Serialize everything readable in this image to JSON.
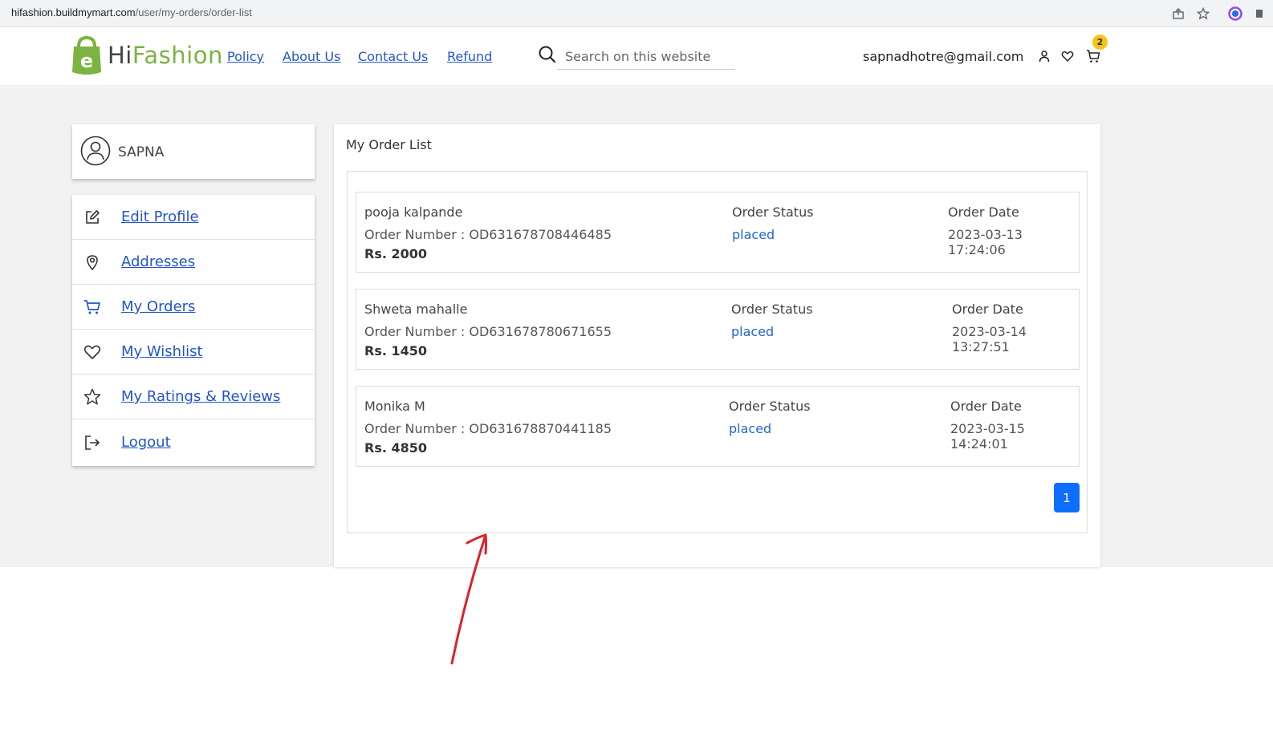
{
  "browser": {
    "url_host": "hifashion.buildmymart.com",
    "url_path": "/user/my-orders/order-list"
  },
  "header": {
    "logo_prefix": "Hi",
    "logo_suffix": "Fashion",
    "nav": [
      {
        "label": "Policy"
      },
      {
        "label": "About Us"
      },
      {
        "label": "Contact Us"
      },
      {
        "label": "Refund"
      }
    ],
    "search_placeholder": "Search on this website",
    "user_email": "sapnadhotre@gmail.com",
    "cart_count": "2"
  },
  "sidebar": {
    "profile_name": "SAPNA",
    "menu": [
      {
        "label": "Edit Profile",
        "icon": "edit-icon"
      },
      {
        "label": "Addresses",
        "icon": "location-pin-icon"
      },
      {
        "label": "My Orders",
        "icon": "cart-icon"
      },
      {
        "label": "My Wishlist",
        "icon": "heart-icon"
      },
      {
        "label": "My Ratings & Reviews",
        "icon": "star-icon"
      },
      {
        "label": "Logout",
        "icon": "logout-icon"
      }
    ]
  },
  "main": {
    "title": "My Order List",
    "orders": [
      {
        "customer": "pooja kalpande",
        "order_number": "Order Number : OD631678708446485",
        "amount": "Rs. 2000",
        "status_label": "Order Status",
        "status": "placed",
        "date_label": "Order Date",
        "date": "2023-03-13 17:24:06"
      },
      {
        "customer": "Shweta mahalle",
        "order_number": "Order Number : OD631678780671655",
        "amount": "Rs. 1450",
        "status_label": "Order Status",
        "status": "placed",
        "date_label": "Order Date",
        "date": "2023-03-14 13:27:51"
      },
      {
        "customer": "Monika M",
        "order_number": "Order Number : OD631678870441185",
        "amount": "Rs. 4850",
        "status_label": "Order Status",
        "status": "placed",
        "date_label": "Order Date",
        "date": "2023-03-15 14:24:01"
      }
    ],
    "pagination": {
      "current_page": "1"
    }
  },
  "colors": {
    "accent_blue": "#0d6efd",
    "link_blue": "#2255cc",
    "logo_green": "#7cb342",
    "badge_yellow": "#f5c518",
    "annotation_red": "#e0202a"
  }
}
